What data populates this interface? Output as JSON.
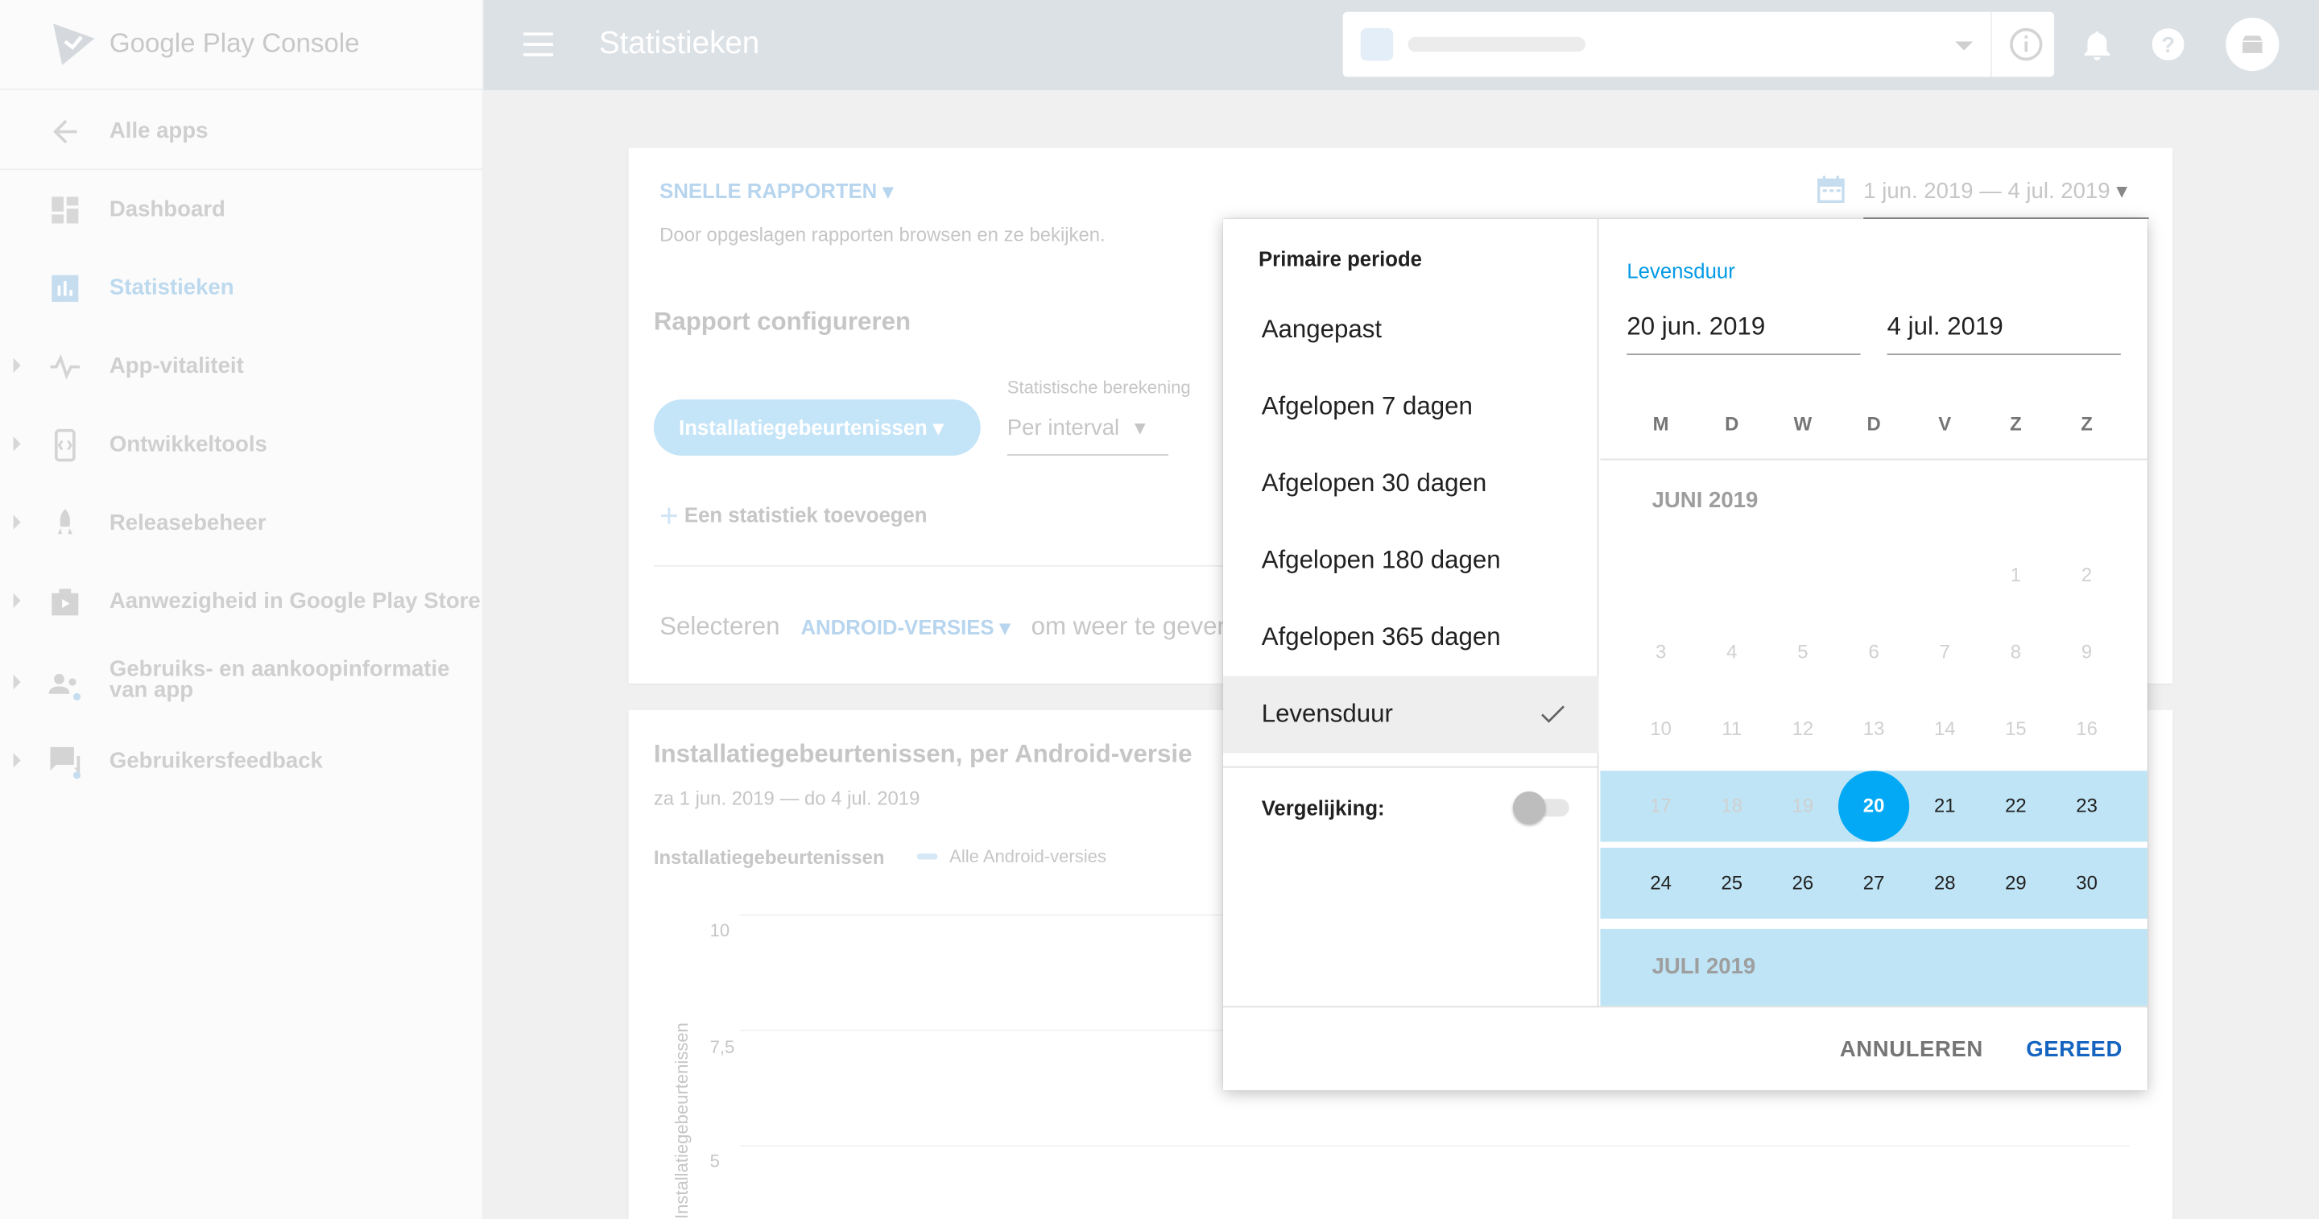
{
  "sidebar": {
    "logo_text": "Google Play Console",
    "items": [
      {
        "label": "Alle apps",
        "icon": "arrow-back-icon"
      },
      {
        "label": "Dashboard",
        "icon": "dashboard-icon"
      },
      {
        "label": "Statistieken",
        "icon": "bar-chart-icon"
      },
      {
        "label": "App-vitaliteit",
        "icon": "vitals-icon"
      },
      {
        "label": "Ontwikkeltools",
        "icon": "dev-tools-icon"
      },
      {
        "label": "Releasebeheer",
        "icon": "rocket-icon"
      },
      {
        "label": "Aanwezigheid in Google Play Store",
        "icon": "play-store-icon"
      },
      {
        "label_line1": "Gebruiks- en aankoopinformatie",
        "label_line2": "van app",
        "icon": "users-icon"
      },
      {
        "label": "Gebruikersfeedback",
        "icon": "feedback-icon"
      }
    ]
  },
  "header": {
    "title": "Statistieken"
  },
  "report": {
    "quick_reports": "SNELLE RAPPORTEN",
    "quick_reports_sub": "Door opgeslagen rapporten browsen en ze bekijken.",
    "date_range": "1 jun. 2019 — 4 jul. 2019",
    "configure_title": "Rapport configureren",
    "metric_chip": "Installatiegebeurtenissen",
    "calc_label": "Statistische berekening",
    "calc_value": "Per interval",
    "add_metric": "Een statistiek toevoegen",
    "select_prefix": "Selecteren",
    "select_dim": "ANDROID-VERSIES",
    "select_suffix": "om weer te geven"
  },
  "chart_card": {
    "title": "Installatiegebeurtenissen, per Android-versie",
    "subtitle": "za 1 jun. 2019 — do 4 jul. 2019",
    "metric": "Installatiegebeurtenissen",
    "legend": "Alle Android-versies",
    "y_ticks": [
      "10",
      "7,5",
      "5"
    ],
    "y_label": "Installatiegebeurtenissen"
  },
  "picker": {
    "primary_title": "Primaire periode",
    "options": [
      {
        "label": "Aangepast",
        "selected": false
      },
      {
        "label": "Afgelopen 7 dagen",
        "selected": false
      },
      {
        "label": "Afgelopen 30 dagen",
        "selected": false
      },
      {
        "label": "Afgelopen 180 dagen",
        "selected": false
      },
      {
        "label": "Afgelopen 365 dagen",
        "selected": false
      },
      {
        "label": "Levensduur",
        "selected": true
      }
    ],
    "compare_label": "Vergelijking:",
    "compare_on": false,
    "mode_label": "Levensduur",
    "start_date": "20 jun. 2019",
    "end_date": "4 jul. 2019",
    "weekdays": [
      "M",
      "D",
      "W",
      "D",
      "V",
      "Z",
      "Z"
    ],
    "month1": "JUNI 2019",
    "month2": "JULI 2019",
    "range_start_day": 20,
    "cancel": "ANNULEREN",
    "done": "GEREED"
  },
  "colors": {
    "accent": "#03a9f4",
    "range": "#bfe4f6",
    "done": "#1565c0"
  }
}
